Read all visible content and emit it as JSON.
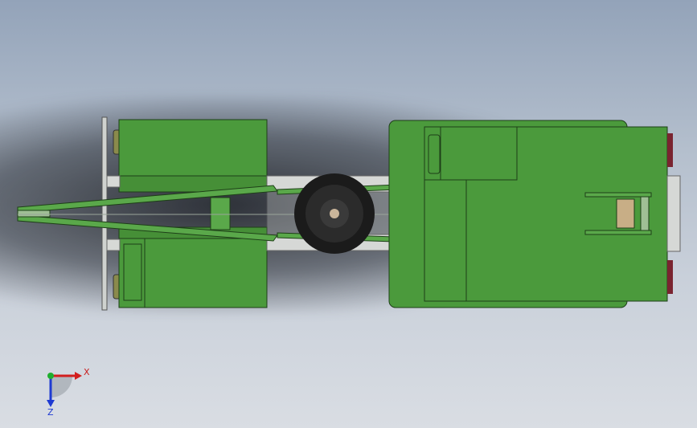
{
  "viewport": {
    "name": "cad-graphics-area",
    "model": "tractor-chassis-top-view"
  },
  "triad": {
    "x_label": "X",
    "z_label": "Z",
    "colors": {
      "x": "#d21e1e",
      "y": "#1fae2e",
      "z": "#1e3ad2"
    }
  },
  "colors": {
    "body_green": "#49923b",
    "body_green_dark": "#2f6b25",
    "frame_gray": "#d6d8d6",
    "tire_black": "#1b1b1b",
    "light_red": "#7a2430"
  }
}
